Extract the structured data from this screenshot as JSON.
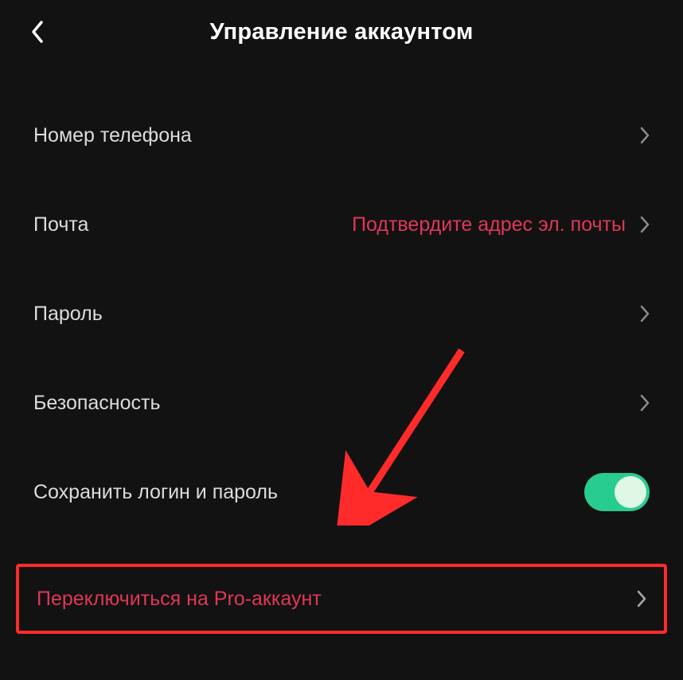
{
  "header": {
    "title": "Управление аккаунтом"
  },
  "rows": {
    "phone": {
      "label": "Номер телефона"
    },
    "email": {
      "label": "Почта",
      "value": "Подтвердите адрес эл. почты"
    },
    "password": {
      "label": "Пароль"
    },
    "security": {
      "label": "Безопасность"
    },
    "saveLogin": {
      "label": "Сохранить логин и пароль",
      "toggle": true
    },
    "pro": {
      "label": "Переключиться на Pro-аккаунт"
    }
  },
  "colors": {
    "accent": "#e03756",
    "highlight": "#ff2b2b",
    "toggleOn": "#29cc8f"
  }
}
